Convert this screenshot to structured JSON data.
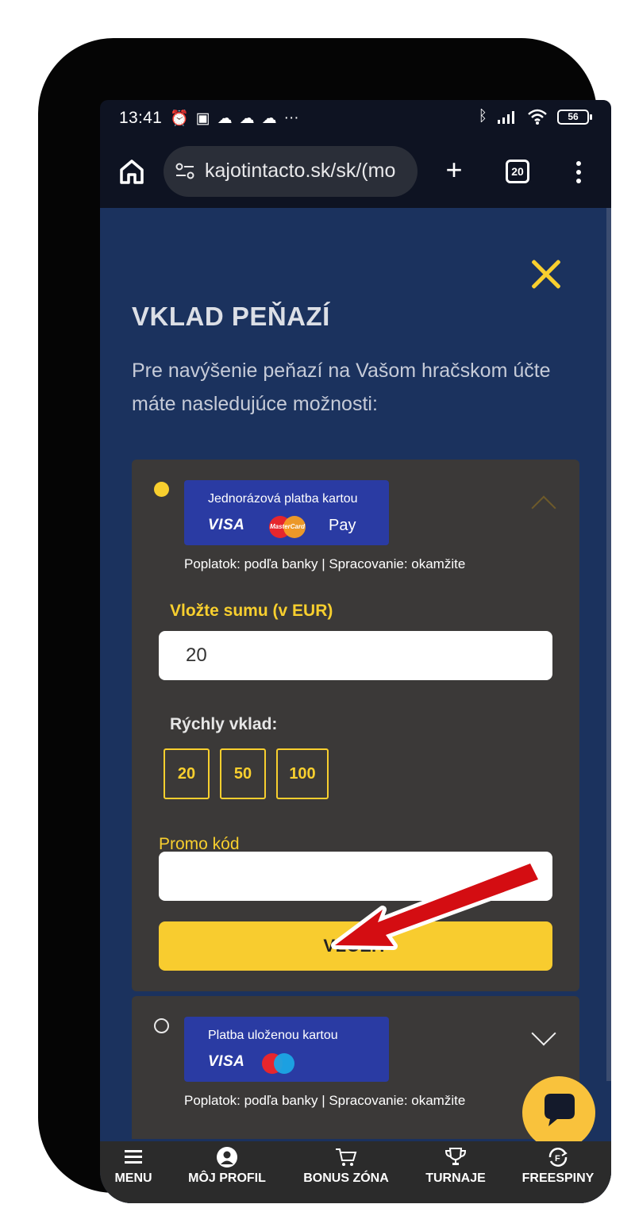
{
  "status": {
    "time": "13:41",
    "battery": "56"
  },
  "browser": {
    "url": "kajotintacto.sk/sk/(mo",
    "tab_count": "20"
  },
  "page": {
    "title": "VKLAD PEŇAZÍ",
    "subtitle": "Pre navýšenie peňazí na Vašom hračskom účte máte nasledujúce možnosti:"
  },
  "card1": {
    "badge_title": "Jednorázová platba kartou",
    "visa": "VISA",
    "mastercard": "MasterCard",
    "applepay": "Pay",
    "fee": "Poplatok: podľa banky | Spracovanie: okamžite",
    "amount_label": "Vložte sumu (v EUR)",
    "amount_value": "20",
    "quick_label": "Rýchly vklad:",
    "quick": [
      "20",
      "50",
      "100"
    ],
    "promo_label": "Promo kód",
    "promo_value": "",
    "submit": "VLOŽIŤ"
  },
  "card2": {
    "badge_title": "Platba uloženou kartou",
    "visa": "VISA",
    "fee": "Poplatok: podľa banky | Spracovanie: okamžite"
  },
  "nav": [
    "MENU",
    "MÔJ PROFIL",
    "BONUS ZÓNA",
    "TURNAJE",
    "FREESPINY"
  ],
  "colors": {
    "accent": "#f8cf2e",
    "page_bg": "#1b325e",
    "card_bg": "#3b3938",
    "arrow": "#d40d12"
  }
}
